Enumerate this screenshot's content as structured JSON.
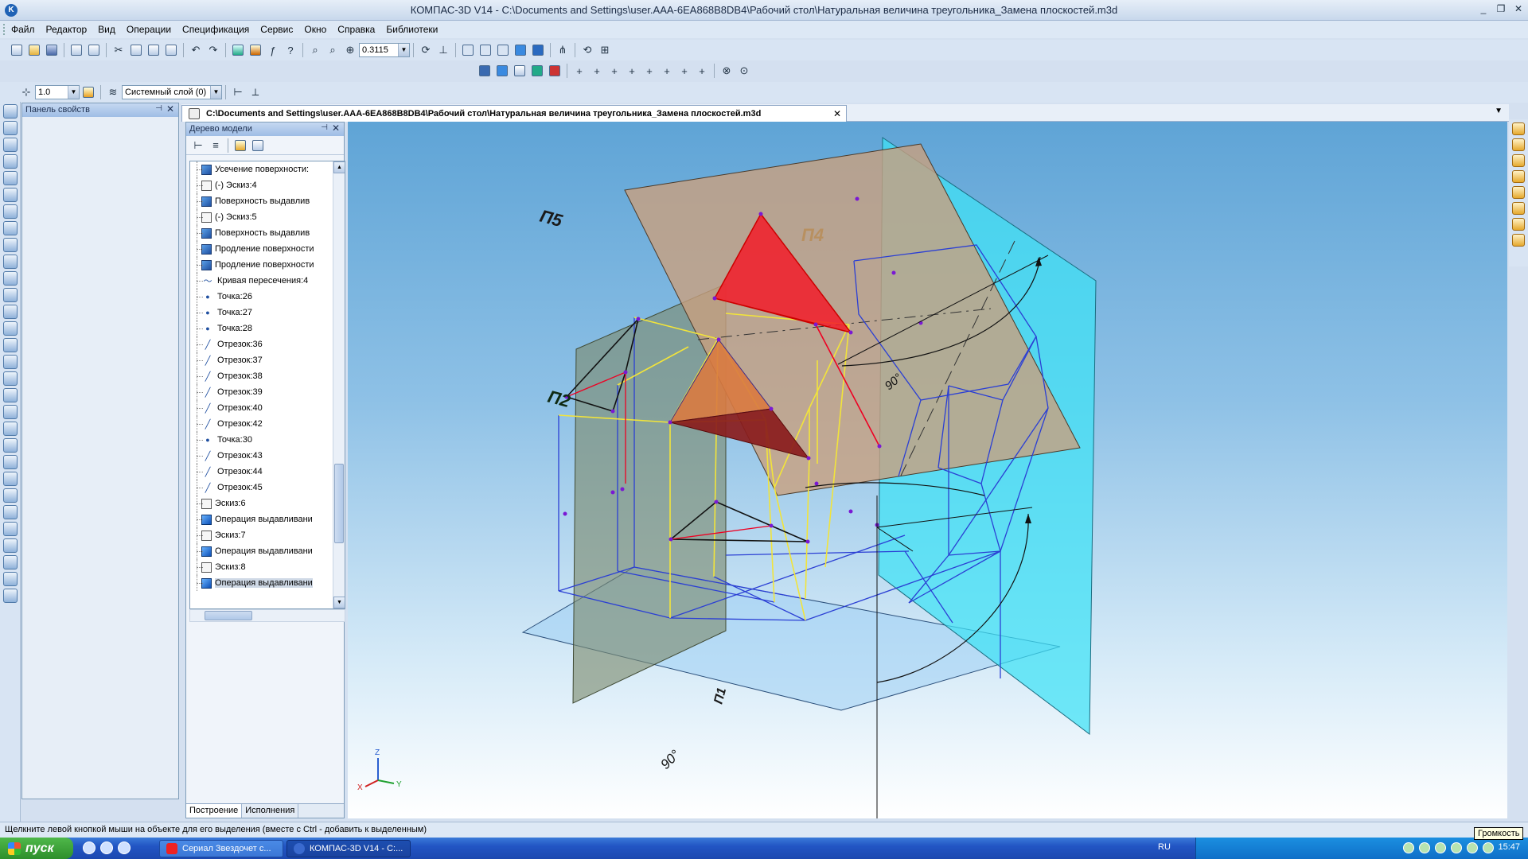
{
  "window": {
    "title": "КОМПАС-3D V14 - C:\\Documents and Settings\\user.AAA-6EA868B8DB4\\Рабочий стол\\Натуральная величина треугольника_Замена плоскостей.m3d",
    "minimize": "_",
    "restore": "❐",
    "close": "✕",
    "app_icon": "K"
  },
  "menu": [
    "Файл",
    "Редактор",
    "Вид",
    "Операции",
    "Спецификация",
    "Сервис",
    "Окно",
    "Справка",
    "Библиотеки"
  ],
  "toolbar": {
    "zoom_value": "0.3115",
    "step_value": "1.0",
    "layer_value": "Системный слой (0)"
  },
  "properties_panel": {
    "title": "Панель свойств",
    "pin": "⊣",
    "close": "✕"
  },
  "model_tree": {
    "title": "Дерево модели",
    "pin": "⊣",
    "close": "✕",
    "items": [
      {
        "icon": "surface",
        "label": "Усечение поверхности:"
      },
      {
        "icon": "sketch",
        "label": "(-) Эскиз:4"
      },
      {
        "icon": "extrude-surface",
        "label": "Поверхность выдавлив"
      },
      {
        "icon": "sketch",
        "label": "(-) Эскиз:5"
      },
      {
        "icon": "extrude-surface",
        "label": "Поверхность выдавлив"
      },
      {
        "icon": "surface",
        "label": "Продление поверхности"
      },
      {
        "icon": "surface",
        "label": "Продление поверхности"
      },
      {
        "icon": "curve",
        "label": "Кривая пересечения:4"
      },
      {
        "icon": "point",
        "label": "Точка:26"
      },
      {
        "icon": "point",
        "label": "Точка:27"
      },
      {
        "icon": "point",
        "label": "Точка:28"
      },
      {
        "icon": "segment",
        "label": "Отрезок:36"
      },
      {
        "icon": "segment",
        "label": "Отрезок:37"
      },
      {
        "icon": "segment",
        "label": "Отрезок:38"
      },
      {
        "icon": "segment",
        "label": "Отрезок:39"
      },
      {
        "icon": "segment",
        "label": "Отрезок:40"
      },
      {
        "icon": "segment",
        "label": "Отрезок:42"
      },
      {
        "icon": "point",
        "label": "Точка:30"
      },
      {
        "icon": "segment",
        "label": "Отрезок:43"
      },
      {
        "icon": "segment",
        "label": "Отрезок:44"
      },
      {
        "icon": "segment",
        "label": "Отрезок:45"
      },
      {
        "icon": "sketch",
        "label": "Эскиз:6"
      },
      {
        "icon": "extrude-op",
        "label": "Операция выдавливани"
      },
      {
        "icon": "sketch",
        "label": "Эскиз:7"
      },
      {
        "icon": "extrude-op",
        "label": "Операция выдавливани"
      },
      {
        "icon": "sketch",
        "label": "Эскиз:8"
      },
      {
        "icon": "extrude-op",
        "label": "Операция выдавливани"
      }
    ],
    "tabs": [
      "Построение",
      "Исполнения"
    ]
  },
  "document_tab": {
    "label": "C:\\Documents and Settings\\user.AAA-6EA868B8DB4\\Рабочий стол\\Натуральная величина треугольника_Замена плоскостей.m3d",
    "close": "✕",
    "menu": "▼"
  },
  "viewport": {
    "plane_labels": [
      "П5",
      "П4",
      "П2",
      "П1"
    ],
    "angle_labels": [
      "90°",
      "90°"
    ],
    "axis_labels": {
      "z": "Z",
      "x": "X",
      "y": "Y"
    }
  },
  "status": {
    "text": "Щелкните левой кнопкой мыши на объекте для его выделения (вместе с Ctrl - добавить к выделенным)"
  },
  "taskbar": {
    "start": "пуск",
    "tasks": [
      {
        "label": "Сериал Звездочет с...",
        "active": false
      },
      {
        "label": "КОМПАС-3D V14 - C:...",
        "active": true
      }
    ],
    "lang": "RU",
    "clock": "15:47",
    "tooltip": "Громкость"
  }
}
